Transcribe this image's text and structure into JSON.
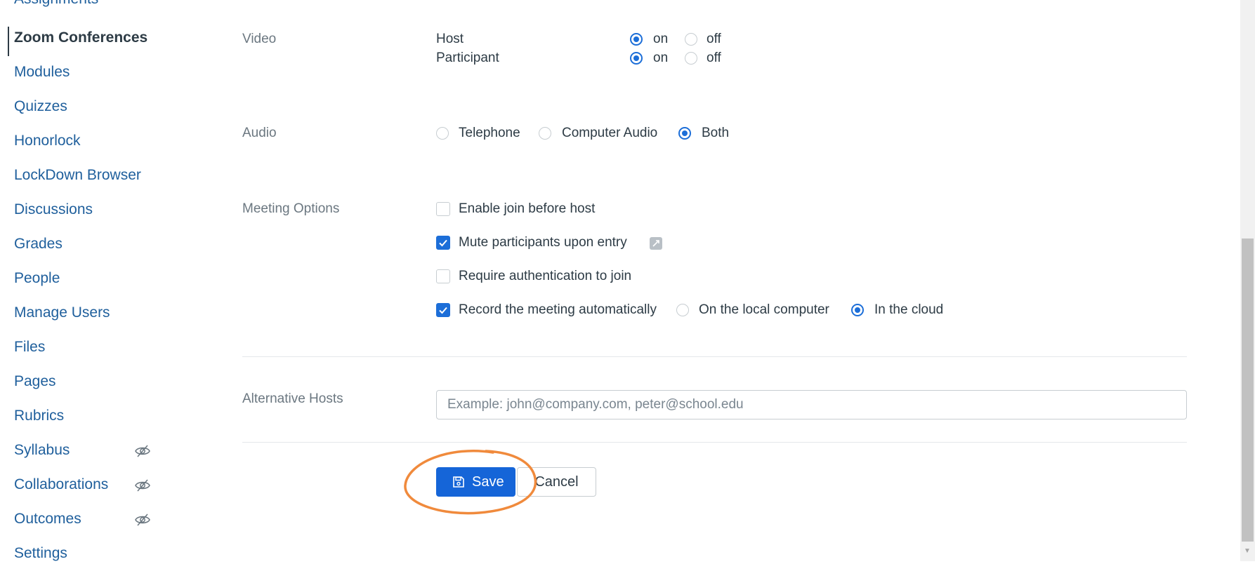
{
  "sidebar": {
    "items": [
      {
        "label": "Zoom Conferences",
        "active": true
      },
      {
        "label": "Modules"
      },
      {
        "label": "Quizzes"
      },
      {
        "label": "Honorlock"
      },
      {
        "label": "LockDown Browser"
      },
      {
        "label": "Discussions"
      },
      {
        "label": "Grades"
      },
      {
        "label": "People"
      },
      {
        "label": "Manage Users"
      },
      {
        "label": "Files"
      },
      {
        "label": "Pages"
      },
      {
        "label": "Rubrics"
      },
      {
        "label": "Syllabus",
        "icon": "eye-slash-icon"
      },
      {
        "label": "Collaborations",
        "icon": "eye-slash-icon"
      },
      {
        "label": "Outcomes",
        "icon": "eye-slash-icon"
      },
      {
        "label": "Settings"
      }
    ]
  },
  "video": {
    "label": "Video",
    "host_label": "Host",
    "participant_label": "Participant",
    "on_label": "on",
    "off_label": "off",
    "host_value": "on",
    "participant_value": "on"
  },
  "audio": {
    "label": "Audio",
    "options": [
      "Telephone",
      "Computer Audio",
      "Both"
    ],
    "selected": "Both"
  },
  "meeting_options": {
    "label": "Meeting Options",
    "enable_join": {
      "label": "Enable join before host",
      "checked": false
    },
    "mute": {
      "label": "Mute participants upon entry",
      "checked": true
    },
    "require_auth": {
      "label": "Require authentication to join",
      "checked": false
    },
    "record": {
      "label": "Record the meeting automatically",
      "checked": true
    },
    "record_local_label": "On the local computer",
    "record_cloud_label": "In the cloud",
    "record_location": "In the cloud"
  },
  "alternative_hosts": {
    "label": "Alternative Hosts",
    "placeholder": "Example: john@company.com, peter@school.edu",
    "value": ""
  },
  "actions": {
    "save_label": "Save",
    "cancel_label": "Cancel"
  },
  "colors": {
    "accent": "#1565d8",
    "highlight": "#f08a3c",
    "nav_link": "#1f5f9c"
  }
}
